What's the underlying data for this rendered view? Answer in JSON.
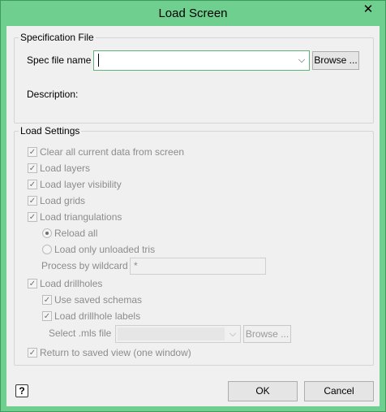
{
  "window": {
    "title": "Load Screen",
    "close_glyph": "✕"
  },
  "spec": {
    "group_title": "Specification File",
    "spec_label": "Spec file name",
    "spec_value": "",
    "browse_label": "Browse ...",
    "description_label": "Description:"
  },
  "load_settings": {
    "group_title": "Load Settings",
    "clear_all": "Clear all current data from screen",
    "load_layers": "Load layers",
    "load_layer_visibility": "Load layer visibility",
    "load_grids": "Load grids",
    "load_triangulations": "Load triangulations",
    "reload_all": "Reload all",
    "load_only_unloaded": "Load only unloaded tris",
    "process_wildcard_label": "Process by wildcard",
    "process_wildcard_value": "*",
    "load_drillholes": "Load drillholes",
    "use_saved_schemas": "Use saved schemas",
    "load_drillhole_labels": "Load drillhole labels",
    "select_mls_label": "Select .mls file",
    "select_mls_value": "",
    "mls_browse_label": "Browse ...",
    "return_saved_view": "Return to saved view (one window)"
  },
  "footer": {
    "help_glyph": "?",
    "ok_label": "OK",
    "cancel_label": "Cancel"
  },
  "colors": {
    "title_bar": "#6fcf8e",
    "client_bg": "#f0f0f0",
    "focus_border": "#5fb37b"
  }
}
